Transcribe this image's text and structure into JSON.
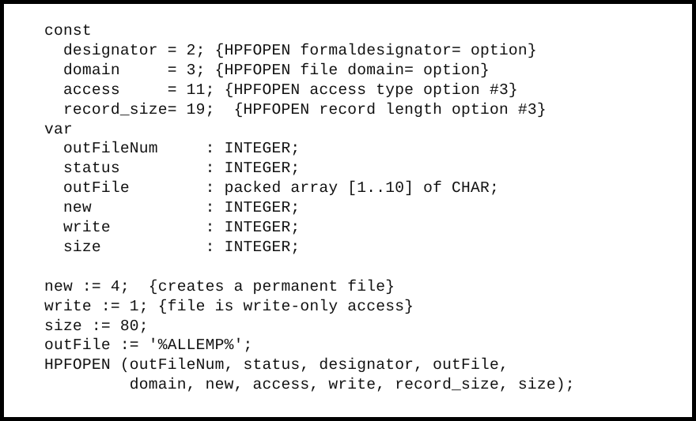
{
  "figure": {
    "kind": "code-listing",
    "language": "Pascal",
    "routine": "HPFOPEN",
    "background_color": "#ffffff",
    "text_color": "#111111",
    "border_color": "#000000"
  },
  "code": {
    "lines": [
      "const",
      "  designator = 2; {HPFOPEN formaldesignator= option}",
      "  domain     = 3; {HPFOPEN file domain= option}",
      "  access     = 11; {HPFOPEN access type option #3}",
      "  record_size= 19;  {HPFOPEN record length option #3}",
      "var",
      "  outFileNum     : INTEGER;",
      "  status         : INTEGER;",
      "  outFile        : packed array [1..10] of CHAR;",
      "  new            : INTEGER;",
      "  write          : INTEGER;",
      "  size           : INTEGER;",
      "",
      "new := 4;  {creates a permanent file}",
      "write := 1; {file is write-only access}",
      "size := 80;",
      "outFile := '%ALLEMP%';",
      "HPFOPEN (outFileNum, status, designator, outFile,",
      "         domain, new, access, write, record_size, size);"
    ]
  }
}
